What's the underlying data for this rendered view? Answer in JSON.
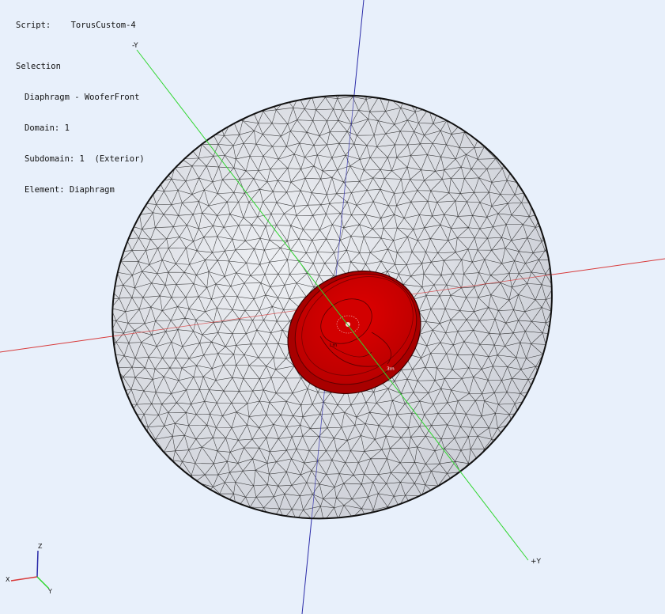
{
  "hud": {
    "script_label": "Script:",
    "script_value": "TorusCustom-4",
    "selection_title": "Selection",
    "selection_lines": [
      "Diaphragm - WooferFront",
      "Domain: 1",
      "Subdomain: 1  (Exterior)",
      "Element: Diaphragm"
    ]
  },
  "axes": {
    "neg_y_label": "-Y",
    "pos_y_label": "+Y",
    "x_color": "#d83a3a",
    "y_color": "#2fd62f",
    "z_color": "#2a2aa8"
  },
  "triad": {
    "x_label": "X",
    "y_label": "Y",
    "z_label": "Z"
  },
  "model": {
    "mesh_fill": "#dfe2e8",
    "mesh_line": "#1a1a1a",
    "diaphragm_color": "#cc0000"
  },
  "icons": {
    "background": "viewport-background",
    "mesh": "triangulated-enclosure-mesh"
  }
}
